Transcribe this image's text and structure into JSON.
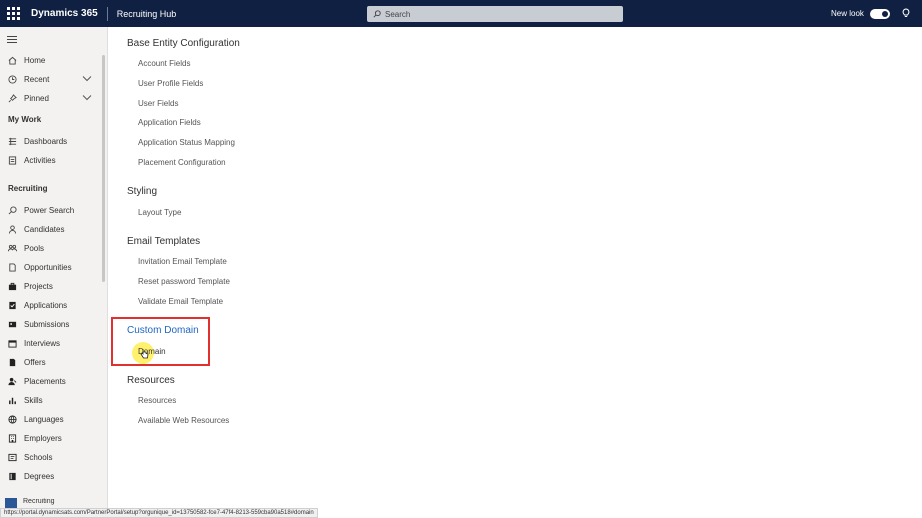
{
  "topbar": {
    "app_name": "Dynamics 365",
    "module_name": "Recruiting Hub",
    "search_placeholder": "Search",
    "new_look_label": "New look",
    "new_look_on": true
  },
  "sidebar": {
    "top_items": [
      {
        "label": "Home",
        "icon": "home-icon"
      },
      {
        "label": "Recent",
        "icon": "clock-icon",
        "expandable": true
      },
      {
        "label": "Pinned",
        "icon": "pin-icon",
        "expandable": true
      }
    ],
    "my_work_header": "My Work",
    "my_work_items": [
      {
        "label": "Dashboards",
        "icon": "dashboard-icon"
      },
      {
        "label": "Activities",
        "icon": "activities-icon"
      }
    ],
    "recruiting_header": "Recruiting",
    "recruiting_items": [
      {
        "label": "Power Search",
        "icon": "search-icon"
      },
      {
        "label": "Candidates",
        "icon": "person-icon"
      },
      {
        "label": "Pools",
        "icon": "pools-icon"
      },
      {
        "label": "Opportunities",
        "icon": "document-icon"
      },
      {
        "label": "Projects",
        "icon": "briefcase-icon"
      },
      {
        "label": "Applications",
        "icon": "applications-icon"
      },
      {
        "label": "Submissions",
        "icon": "submissions-icon"
      },
      {
        "label": "Interviews",
        "icon": "calendar-icon"
      },
      {
        "label": "Offers",
        "icon": "offers-icon"
      },
      {
        "label": "Placements",
        "icon": "placements-icon"
      },
      {
        "label": "Skills",
        "icon": "skills-icon"
      },
      {
        "label": "Languages",
        "icon": "globe-icon"
      },
      {
        "label": "Employers",
        "icon": "building-icon"
      },
      {
        "label": "Schools",
        "icon": "school-icon"
      },
      {
        "label": "Degrees",
        "icon": "book-icon"
      }
    ],
    "area_switcher_label": "Recruiting"
  },
  "main": {
    "sections": [
      {
        "title": "Base Entity Configuration",
        "links": [
          "Account Fields",
          "User Profile Fields",
          "User Fields",
          "Application Fields",
          "Application Status Mapping",
          "Placement Configuration"
        ]
      },
      {
        "title": "Styling",
        "links": [
          "Layout Type"
        ]
      },
      {
        "title": "Email Templates",
        "links": [
          "Invitation Email Template",
          "Reset password Template",
          "Validate Email Template"
        ]
      },
      {
        "title": "Custom Domain",
        "links": [
          "Domain"
        ],
        "highlighted": true
      },
      {
        "title": "Resources",
        "links": [
          "Resources",
          "Available Web Resources"
        ]
      }
    ]
  },
  "statusbar": {
    "url": "https://portal.dynamicsats.com/PartnerPortal/setup?orgunique_id=13750582-fce7-47f4-8213-559cba90a518#domain"
  },
  "colors": {
    "topbar_bg": "#0f2042",
    "sidebar_bg": "#f3f2f1",
    "highlight_border": "#e0312f",
    "accent_link": "#2266c4",
    "cursor_highlight": "#ffec3c"
  }
}
